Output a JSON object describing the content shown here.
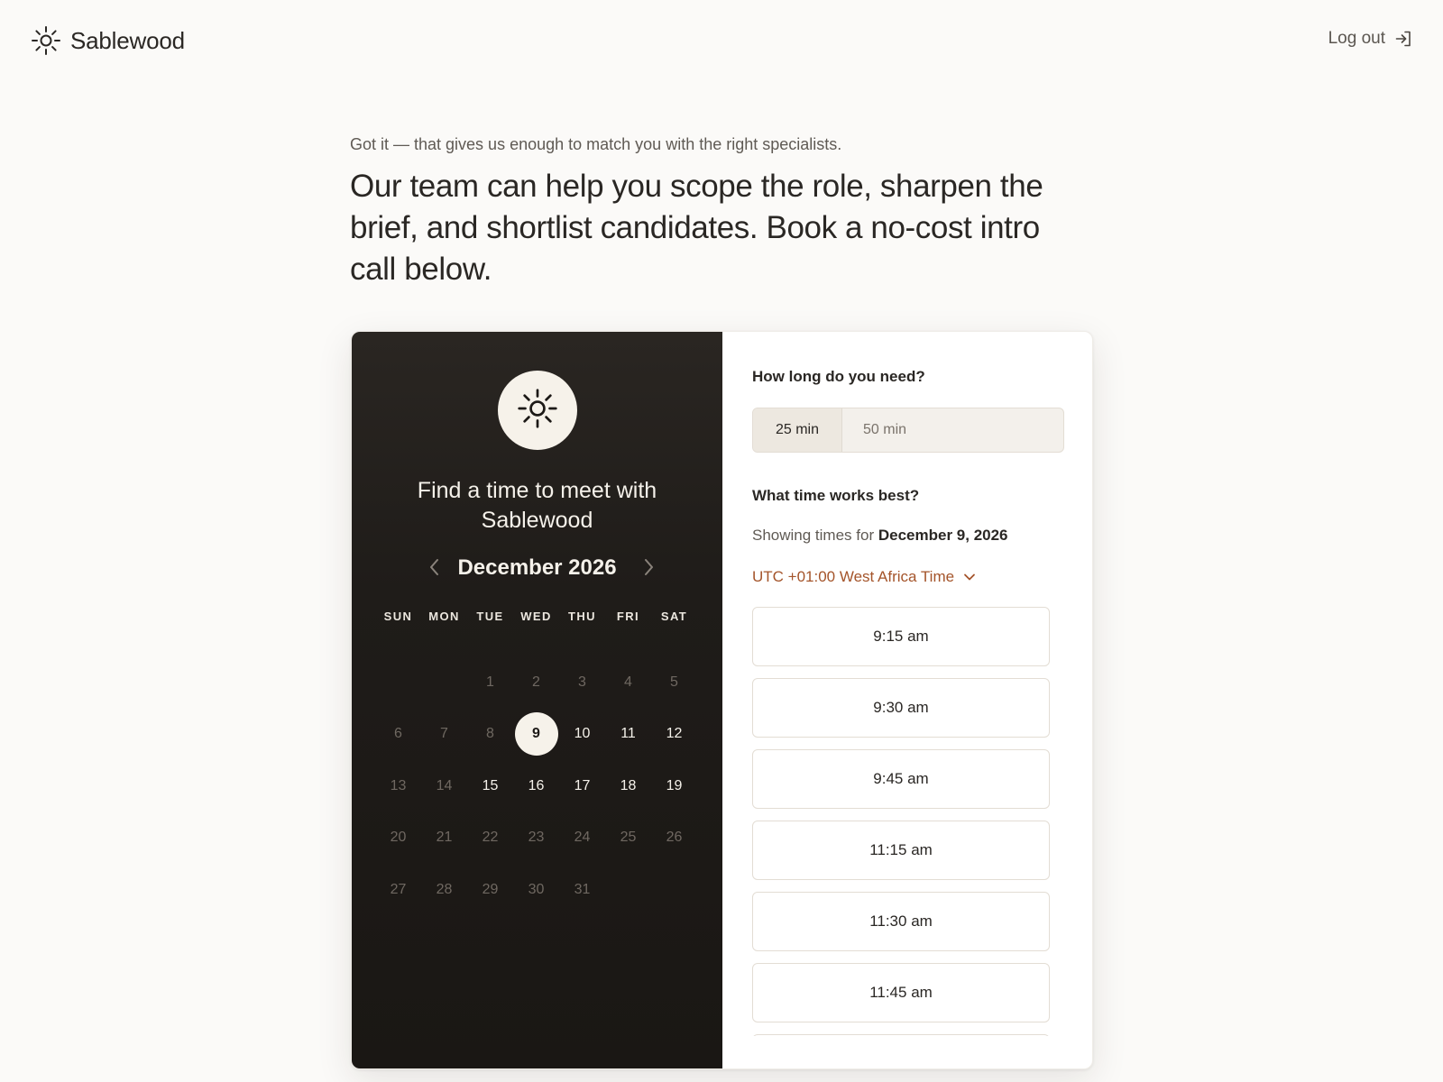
{
  "brand": {
    "name": "Sablewood",
    "icon": "sun-icon"
  },
  "header": {
    "logout_label": "Log out",
    "logout_icon": "log-in-arrow-icon"
  },
  "intro": {
    "subtitle": "Got it — that gives us enough to match you with the right specialists.",
    "title": "Our team can help you scope the role, sharpen the brief, and shortlist candidates. Book a no-cost intro call below."
  },
  "calendar": {
    "heading": "Find a time to meet with Sablewood",
    "month_label": "December 2026",
    "weekdays": [
      "SUN",
      "MON",
      "TUE",
      "WED",
      "THU",
      "FRI",
      "SAT"
    ],
    "leading_blanks": 2,
    "days": [
      {
        "n": "1",
        "available": false
      },
      {
        "n": "2",
        "available": false
      },
      {
        "n": "3",
        "available": false
      },
      {
        "n": "4",
        "available": false
      },
      {
        "n": "5",
        "available": false
      },
      {
        "n": "6",
        "available": false
      },
      {
        "n": "7",
        "available": false
      },
      {
        "n": "8",
        "available": false
      },
      {
        "n": "9",
        "available": true,
        "selected": true
      },
      {
        "n": "10",
        "available": true
      },
      {
        "n": "11",
        "available": true
      },
      {
        "n": "12",
        "available": true
      },
      {
        "n": "13",
        "available": false
      },
      {
        "n": "14",
        "available": false
      },
      {
        "n": "15",
        "available": true
      },
      {
        "n": "16",
        "available": true
      },
      {
        "n": "17",
        "available": true
      },
      {
        "n": "18",
        "available": true
      },
      {
        "n": "19",
        "available": true
      },
      {
        "n": "20",
        "available": false
      },
      {
        "n": "21",
        "available": false
      },
      {
        "n": "22",
        "available": false
      },
      {
        "n": "23",
        "available": false
      },
      {
        "n": "24",
        "available": false
      },
      {
        "n": "25",
        "available": false
      },
      {
        "n": "26",
        "available": false
      },
      {
        "n": "27",
        "available": false
      },
      {
        "n": "28",
        "available": false
      },
      {
        "n": "29",
        "available": false
      },
      {
        "n": "30",
        "available": false
      },
      {
        "n": "31",
        "available": false
      }
    ]
  },
  "booking": {
    "duration_label": "How long do you need?",
    "duration_options": [
      "25 min",
      "50 min"
    ],
    "duration_selected": "25 min",
    "time_label": "What time works best?",
    "showing_prefix": "Showing times for",
    "showing_date": "December 9, 2026",
    "timezone": "UTC +01:00 West Africa Time",
    "slots": [
      "9:15 am",
      "9:30 am",
      "9:45 am",
      "11:15 am",
      "11:30 am",
      "11:45 am"
    ]
  },
  "colors": {
    "page_bg": "#fbfaf8",
    "panel_dark": "#1c1916",
    "accent_timezone": "#a4542a",
    "selected_day_bg": "#f6f2ea"
  }
}
